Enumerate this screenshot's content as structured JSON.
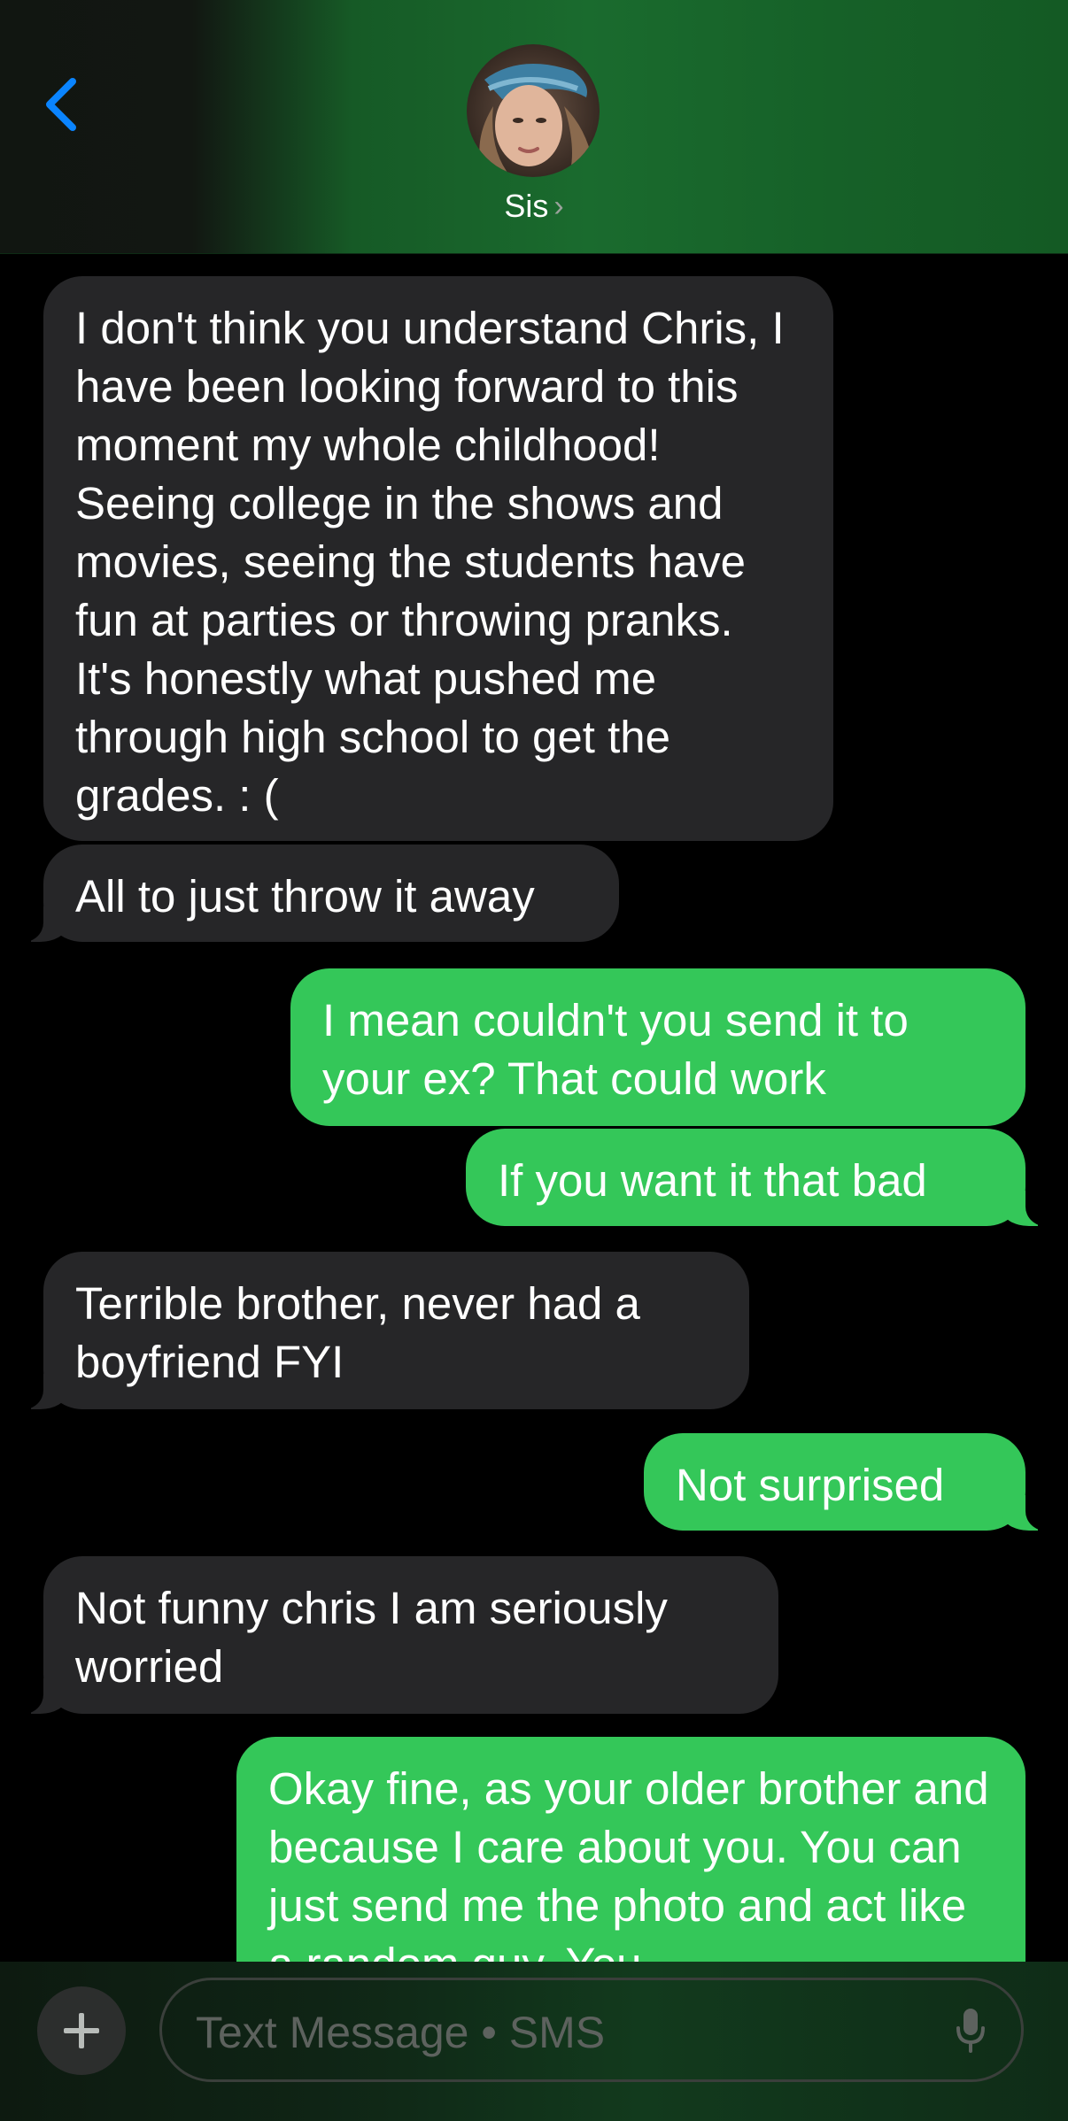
{
  "header": {
    "contact_name": "Sis",
    "chevron": "›",
    "back_icon": "chevron-left-icon"
  },
  "messages": [
    {
      "from": "them",
      "text": "I don't think you understand Chris, I have been looking forward to this moment my whole childhood! Seeing college in the shows and movies, seeing the students have fun at parties or throwing pranks. It's honestly what pushed me through high school to get the grades. : ("
    },
    {
      "from": "them",
      "text": "All to just throw it away"
    },
    {
      "from": "me",
      "text": "I mean couldn't you send it to your ex? That could work"
    },
    {
      "from": "me",
      "text": "If you want it that bad"
    },
    {
      "from": "them",
      "text": "Terrible brother, never had a boyfriend FYI"
    },
    {
      "from": "me",
      "text": "Not surprised"
    },
    {
      "from": "them",
      "text": "Not funny chris I am seriously worried"
    },
    {
      "from": "me",
      "text": "Okay fine, as your older brother and because I care about you. You can just send me the photo and act like a random guy. You"
    }
  ],
  "input": {
    "placeholder": "Text Message • SMS",
    "plus_icon": "plus-icon",
    "mic_icon": "microphone-icon"
  },
  "colors": {
    "outgoing_bubble": "#34c759",
    "incoming_bubble": "#262628",
    "accent": "#0a84ff"
  }
}
